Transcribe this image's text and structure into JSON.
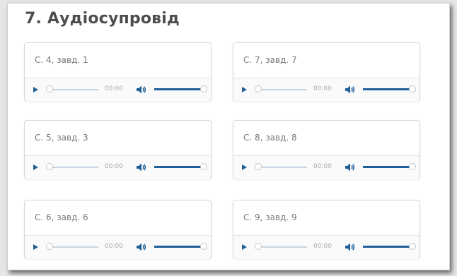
{
  "section": {
    "title": "7. Аудіосупровід"
  },
  "tracks": [
    {
      "label": "С. 4, завд. 1",
      "time": "00:00",
      "progress": 0,
      "volume": 1.0
    },
    {
      "label": "С. 7, завд. 7",
      "time": "00:00",
      "progress": 0,
      "volume": 1.0
    },
    {
      "label": "С. 5, завд. 3",
      "time": "00:00",
      "progress": 0,
      "volume": 1.0
    },
    {
      "label": "С. 8, завд. 8",
      "time": "00:00",
      "progress": 0,
      "volume": 1.0
    },
    {
      "label": "С. 6, завд. 6",
      "time": "00:00",
      "progress": 0,
      "volume": 1.0
    },
    {
      "label": "С. 9, завд. 9",
      "time": "00:00",
      "progress": 0,
      "volume": 1.0
    }
  ],
  "icons": {
    "play": "play-icon",
    "volume": "volume-icon"
  },
  "colors": {
    "accent": "#1e5f97",
    "track": "#c8d4df",
    "title": "#4d4d4d"
  }
}
